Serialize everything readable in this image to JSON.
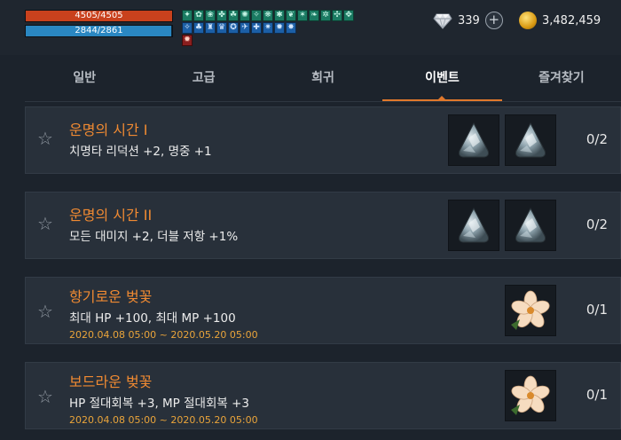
{
  "hud": {
    "hp_text": "4505/4505",
    "hp_fraction": 1.0,
    "mp_text": "2844/2861",
    "mp_fraction": 0.994,
    "buffs_row1": [
      "✦",
      "✿",
      "❀",
      "✤",
      "☘",
      "✺",
      "✧",
      "❋",
      "✱",
      "❦",
      "✶",
      "❧",
      "✲",
      "✣",
      "✥"
    ],
    "buffs_row2": [
      "✧",
      "♣",
      "♜",
      "♛",
      "✪",
      "✈",
      "✚",
      "✷",
      "✹",
      "✸"
    ],
    "debuff": "✹",
    "gems": "339",
    "gold": "3,482,459"
  },
  "tabs": [
    {
      "label": "일반",
      "active": false
    },
    {
      "label": "고급",
      "active": false
    },
    {
      "label": "희귀",
      "active": false
    },
    {
      "label": "이벤트",
      "active": true
    },
    {
      "label": "즐겨찾기",
      "active": false
    }
  ],
  "items": [
    {
      "title": "운명의 시간 I",
      "desc": "치명타 리덕션 +2, 명중 +1",
      "date": "",
      "count": "0/2",
      "materials": [
        "crystal-stone",
        "crystal-stone"
      ]
    },
    {
      "title": "운명의 시간 II",
      "desc": "모든 대미지 +2, 더블 저항 +1%",
      "date": "",
      "count": "0/2",
      "materials": [
        "crystal-stone",
        "crystal-stone"
      ]
    },
    {
      "title": "향기로운 벚꽃",
      "desc": "최대 HP +100, 최대 MP +100",
      "date": "2020.04.08 05:00 ~ 2020.05.20 05:00",
      "count": "0/1",
      "materials": [
        "cherry-blossom"
      ]
    },
    {
      "title": "보드라운 벚꽃",
      "desc": "HP 절대회복 +3, MP 절대회복 +3",
      "date": "2020.04.08 05:00 ~ 2020.05.20 05:00",
      "count": "0/1",
      "materials": [
        "cherry-blossom"
      ]
    }
  ],
  "colors": {
    "accent": "#e0782c",
    "title": "#f08a32",
    "date": "#e9a43a",
    "hp": "#c9411d",
    "mp": "#2a87c2"
  }
}
